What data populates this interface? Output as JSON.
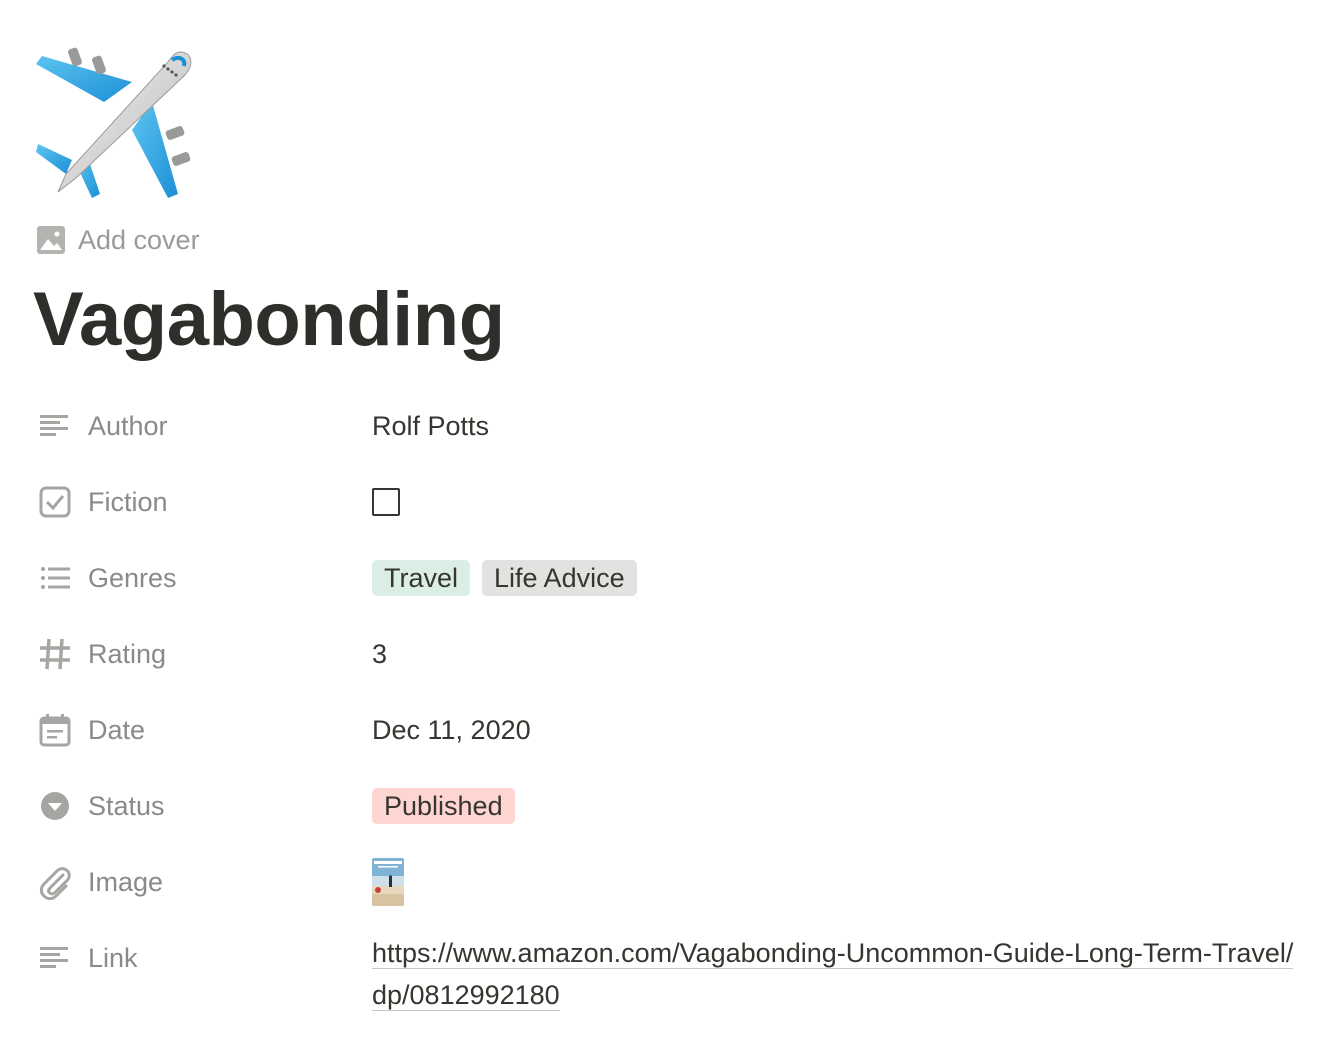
{
  "page": {
    "icon": "airplane-emoji",
    "add_cover_label": "Add cover",
    "title": "Vagabonding"
  },
  "properties": {
    "author": {
      "name": "Author",
      "icon": "text-lines-icon",
      "value": "Rolf Potts"
    },
    "fiction": {
      "name": "Fiction",
      "icon": "checkbox-icon",
      "checked": false
    },
    "genres": {
      "name": "Genres",
      "icon": "list-icon",
      "tags": [
        "Travel",
        "Life Advice"
      ]
    },
    "rating": {
      "name": "Rating",
      "icon": "hash-icon",
      "value": "3"
    },
    "date": {
      "name": "Date",
      "icon": "calendar-icon",
      "value": "Dec 11, 2020"
    },
    "status": {
      "name": "Status",
      "icon": "select-chevron-icon",
      "value": "Published"
    },
    "image": {
      "name": "Image",
      "icon": "paperclip-icon",
      "thumbnail": "book-cover-thumbnail"
    },
    "link": {
      "name": "Link",
      "icon": "text-lines-icon",
      "value": "https://www.amazon.com/Vagabonding-Uncommon-Guide-Long-Term-Travel/dp/0812992180"
    }
  },
  "colors": {
    "tag_travel": "#dbeee5",
    "tag_life_advice": "#e3e2e0",
    "tag_published": "#ffd5d2",
    "muted_text": "#8b8a86",
    "body_text": "#37352f"
  }
}
